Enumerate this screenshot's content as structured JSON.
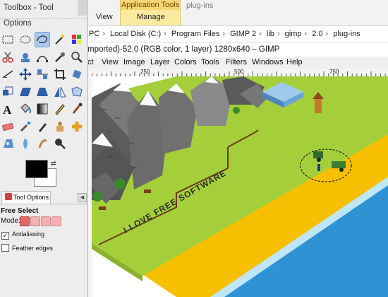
{
  "toolbox": {
    "title": "Toolbox - Tool Options",
    "tools": [
      {
        "name": "rect-select",
        "active": false
      },
      {
        "name": "ellipse-select",
        "active": false
      },
      {
        "name": "free-select",
        "active": true
      },
      {
        "name": "fuzzy-select",
        "active": false
      },
      {
        "name": "select-by-color",
        "active": false
      },
      {
        "name": "scissors-select",
        "active": false
      },
      {
        "name": "foreground-select",
        "active": false
      },
      {
        "name": "paths",
        "active": false
      },
      {
        "name": "color-picker",
        "active": false
      },
      {
        "name": "zoom",
        "active": false
      },
      {
        "name": "measure",
        "active": false
      },
      {
        "name": "move",
        "active": false
      },
      {
        "name": "align",
        "active": false
      },
      {
        "name": "crop",
        "active": false
      },
      {
        "name": "rotate",
        "active": false
      },
      {
        "name": "scale",
        "active": false
      },
      {
        "name": "shear",
        "active": false
      },
      {
        "name": "perspective",
        "active": false
      },
      {
        "name": "flip",
        "active": false
      },
      {
        "name": "cage-transform",
        "active": false
      },
      {
        "name": "text",
        "active": false
      },
      {
        "name": "bucket-fill",
        "active": false
      },
      {
        "name": "blend",
        "active": false
      },
      {
        "name": "pencil",
        "active": false
      },
      {
        "name": "paintbrush",
        "active": false
      },
      {
        "name": "eraser",
        "active": false
      },
      {
        "name": "airbrush",
        "active": false
      },
      {
        "name": "ink",
        "active": false
      },
      {
        "name": "clone",
        "active": false
      },
      {
        "name": "heal",
        "active": false
      },
      {
        "name": "perspective-clone",
        "active": false
      },
      {
        "name": "blur-sharpen",
        "active": false
      },
      {
        "name": "smudge",
        "active": false
      },
      {
        "name": "dodge-burn",
        "active": false
      }
    ],
    "fg_color": "#000000",
    "bg_color": "#ffffff"
  },
  "tool_options": {
    "tab_label": "Tool Options",
    "tool_name": "Free Select",
    "mode_label": "Mode:",
    "antialiasing_label": "Antialiasing",
    "antialiasing_checked": true,
    "feather_label": "Feather edges",
    "feather_checked": false
  },
  "explorer": {
    "context_tab_header": "Application Tools",
    "context_tab": "Manage",
    "view_tab": "View",
    "window_title": "plug-ins",
    "path": [
      "PC",
      "Local Disk (C:)",
      "Program Files",
      "GIMP 2",
      "lib",
      "gimp",
      "2.0",
      "plug-ins"
    ]
  },
  "gimp": {
    "title": "mported)-52.0 (RGB color, 1 layer) 1280x640 – GIMP",
    "menu": [
      "ct",
      "View",
      "Image",
      "Layer",
      "Colors",
      "Tools",
      "Filters",
      "Windows",
      "Help"
    ],
    "ruler_labels": [
      "250",
      "500",
      "750"
    ]
  },
  "canvas": {
    "banner_text": "I LOVE FREE SOFTWARE",
    "colors": {
      "grass": "#a4cf3a",
      "sand": "#f6c000",
      "sea": "#2f92d2",
      "foam": "#bfe6f7",
      "mountain": "#6d6d6d",
      "snow": "#fafafa",
      "fence": "#6b3d1a"
    }
  }
}
